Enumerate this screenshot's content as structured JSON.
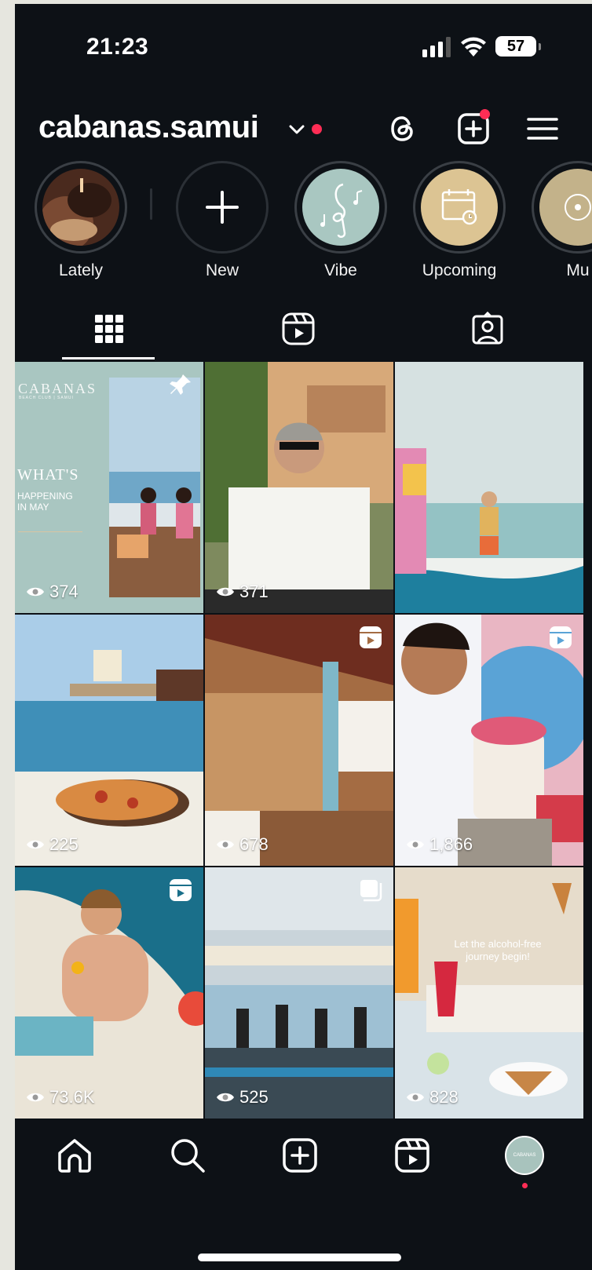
{
  "status_bar": {
    "time": "21:23",
    "battery": "57"
  },
  "header": {
    "username": "cabanas.samui"
  },
  "highlights": [
    {
      "label": "Lately"
    },
    {
      "label": "New"
    },
    {
      "label": "Vibe"
    },
    {
      "label": "Upcoming"
    },
    {
      "label": "Mu"
    }
  ],
  "tabs": [
    "grid",
    "reels",
    "tagged"
  ],
  "posts": [
    {
      "views": "374",
      "type": "pinned",
      "text": {
        "brand": "CABANAS",
        "sub": "BEACH CLUB | SAMUI",
        "headline": "WHAT'S",
        "line2": "HAPPENING",
        "line3": "IN MAY"
      }
    },
    {
      "views": "371",
      "type": "post"
    },
    {
      "views": "",
      "type": "post"
    },
    {
      "views": "225",
      "type": "post"
    },
    {
      "views": "678",
      "type": "reel"
    },
    {
      "views": "1,866",
      "type": "reel"
    },
    {
      "views": "73.6K",
      "type": "reel"
    },
    {
      "views": "525",
      "type": "carousel"
    },
    {
      "views": "828",
      "type": "post",
      "text": {
        "caption1": "Let the alcohol-free",
        "caption2": "journey begin!"
      }
    }
  ],
  "bottom_nav": {
    "avatar_text": "CABANAS"
  },
  "colors": {
    "background": "#0d1116",
    "notification": "#ff2d55",
    "page_bg": "#e6e6df"
  }
}
